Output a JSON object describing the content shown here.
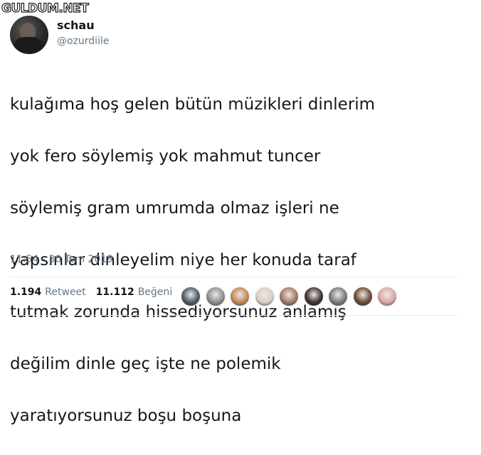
{
  "watermark": "GULDUM.NET",
  "author": {
    "display_name": "schau",
    "handle": "@ozurdiile"
  },
  "tweet": {
    "lines": [
      "kulağıma hoş gelen bütün müzikleri dinlerim",
      "yok fero söylemiş yok mahmut tuncer",
      "söylemiş gram umrumda olmaz işleri ne",
      "yapsınlar dinleyelim niye her konuda taraf",
      "tutmak zorunda hissediyorsunuz anlamış",
      "değilim dinle geç işte ne polemik",
      "yaratıyorsunuz boşu boşuna"
    ],
    "timestamp": "11:54 - 30 Tem 2019"
  },
  "stats": {
    "retweets": "1.194",
    "retweets_label": "Retweet",
    "likes": "11.112",
    "likes_label": "Beğeni"
  },
  "likers": [
    {
      "name": "liker-avatar-1",
      "color": "#4a5a6a"
    },
    {
      "name": "liker-avatar-2",
      "color": "#8a8f94"
    },
    {
      "name": "liker-avatar-3",
      "color": "#c08a5a"
    },
    {
      "name": "liker-avatar-4",
      "color": "#d8d0c8"
    },
    {
      "name": "liker-avatar-5",
      "color": "#a07868"
    },
    {
      "name": "liker-avatar-6",
      "color": "#3a3230"
    },
    {
      "name": "liker-avatar-7",
      "color": "#7a7a7a"
    },
    {
      "name": "liker-avatar-8",
      "color": "#6a4a38"
    },
    {
      "name": "liker-avatar-9",
      "color": "#d8a8a8"
    }
  ]
}
